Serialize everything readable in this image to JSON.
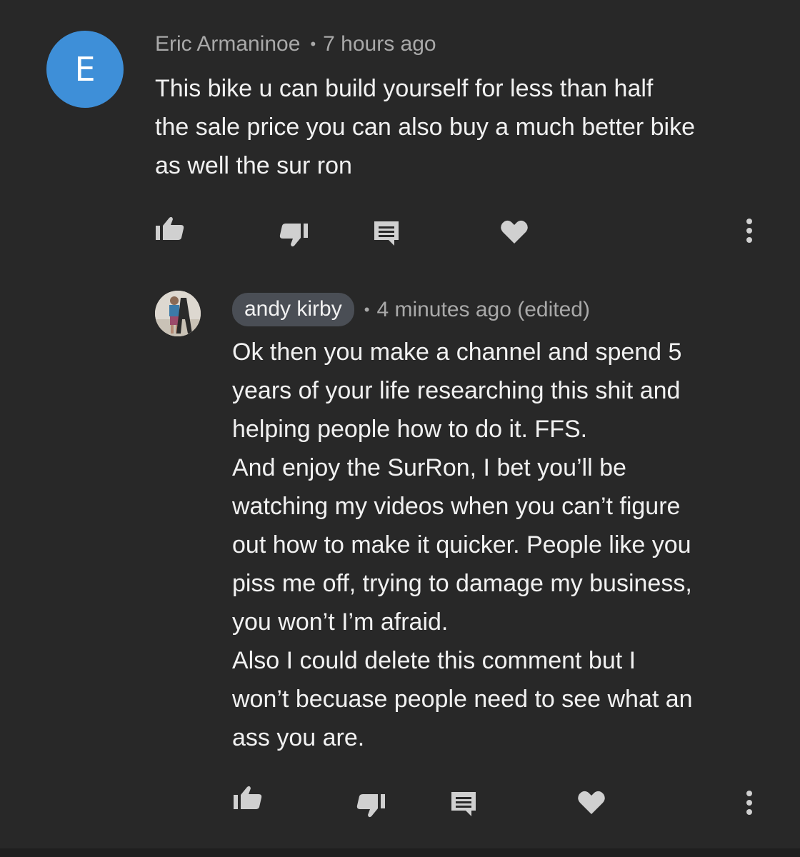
{
  "comments": [
    {
      "avatar_letter": "E",
      "author": "Eric Armaninoe",
      "separator": "•",
      "time": "7 hours ago",
      "text": "This bike u can build yourself for less than half\nthe sale price you can also buy a much better bike\nas well the sur ron"
    }
  ],
  "reply": {
    "author": "andy kirby",
    "separator": "•",
    "time": "4 minutes ago (edited)",
    "text": "Ok then you make a channel and spend 5\nyears of your life researching this shit and\nhelping people how to do it. FFS.\nAnd enjoy the SurRon, I bet you’ll be\nwatching my videos when you can’t figure\nout how to make it quicker. People like you\npiss me off, trying to damage my business,\nyou won’t I’m afraid.\nAlso I could delete this comment but I\nwon’t becuase people need to see what an\nass you are."
  },
  "icons": {
    "like": "thumbs-up-icon",
    "dislike": "thumbs-down-icon",
    "reply": "reply-comment-icon",
    "heart": "heart-icon",
    "more": "more-vertical-icon"
  },
  "colors": {
    "background": "#282828",
    "avatar_blue": "#3e8fd8",
    "pill": "#4a4e55",
    "icon": "#d0d0d0"
  }
}
